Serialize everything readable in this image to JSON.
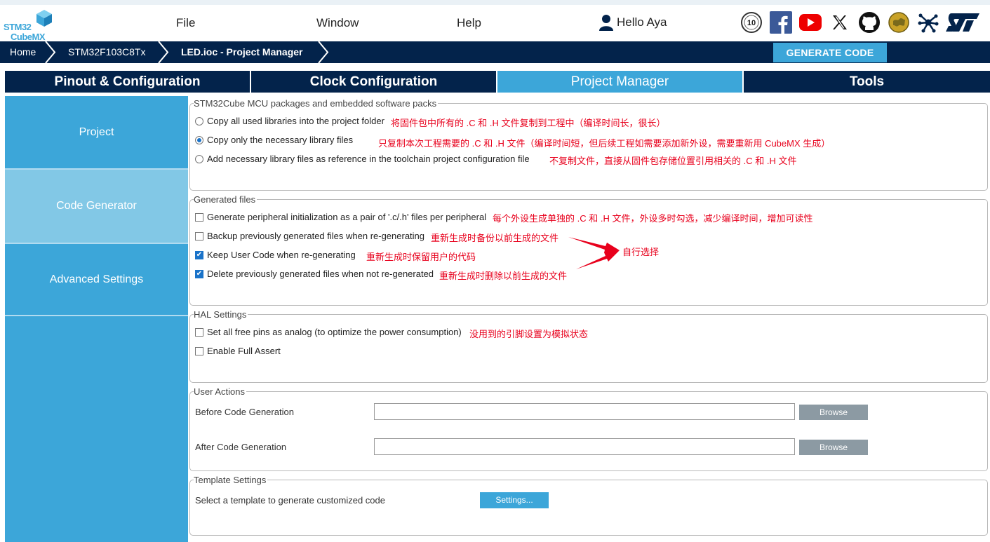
{
  "app": {
    "logo_line1": "STM32",
    "logo_line2": "CubeMX"
  },
  "menu": {
    "file": "File",
    "window": "Window",
    "help": "Help",
    "user": "Hello Aya"
  },
  "socials": [
    "10-years-badge-icon",
    "facebook-icon",
    "youtube-icon",
    "x-twitter-icon",
    "github-icon",
    "community-icon",
    "network-icon",
    "st-logo-icon"
  ],
  "breadcrumb": {
    "home": "Home",
    "mcu": "STM32F103C8Tx",
    "project": "LED.ioc - Project Manager"
  },
  "generate_label": "GENERATE CODE",
  "tabs": {
    "pinout": "Pinout & Configuration",
    "clock": "Clock Configuration",
    "project_manager": "Project Manager",
    "tools": "Tools"
  },
  "leftnav": {
    "project": "Project",
    "code_generator": "Code Generator",
    "advanced": "Advanced Settings"
  },
  "packages": {
    "legend": "STM32Cube MCU packages and embedded software packs",
    "opt1": "Copy all used libraries into the project folder",
    "opt1_note": "将固件包中所有的 .C 和 .H 文件复制到工程中（编译时间长，很长）",
    "opt2": "Copy only the necessary library files",
    "opt2_note": "只复制本次工程需要的 .C 和 .H 文件（编译时间短，但后续工程如需要添加新外设，需要重新用 CubeMX 生成）",
    "opt3": "Add necessary library files as reference in the toolchain project configuration file",
    "opt3_note": "不复制文件，直接从固件包存储位置引用相关的 .C 和 .H 文件",
    "selected": 2
  },
  "generated": {
    "legend": "Generated files",
    "opt1": "Generate peripheral initialization as a pair of '.c/.h' files per peripheral",
    "opt1_note": "每个外设生成单独的 .C 和 .H 文件，外设多时勾选，减少编译时间，增加可读性",
    "opt2": "Backup previously generated files when re-generating",
    "opt2_note": "重新生成时备份以前生成的文件",
    "opt3": "Keep User Code when re-generating",
    "opt3_note": "重新生成时保留用户的代码",
    "opt4": "Delete previously generated files when not re-generated",
    "opt4_note": "重新生成时删除以前生成的文件",
    "arrow_note": "自行选择",
    "checked": [
      false,
      false,
      true,
      true
    ]
  },
  "hal": {
    "legend": "HAL Settings",
    "opt1": "Set all free pins as analog (to optimize the power consumption)",
    "opt1_note": "没用到的引脚设置为模拟状态",
    "opt2": "Enable Full Assert",
    "checked": [
      false,
      false
    ]
  },
  "user_actions": {
    "legend": "User Actions",
    "before_label": "Before Code Generation",
    "after_label": "After Code Generation",
    "before_value": "",
    "after_value": "",
    "browse": "Browse"
  },
  "template": {
    "legend": "Template Settings",
    "label": "Select a template to generate customized code",
    "button": "Settings..."
  },
  "colors": {
    "navy": "#03234b",
    "accent": "#3ca6d9",
    "nav_selected": "#82c8e6",
    "annotation": "#e8001c"
  }
}
